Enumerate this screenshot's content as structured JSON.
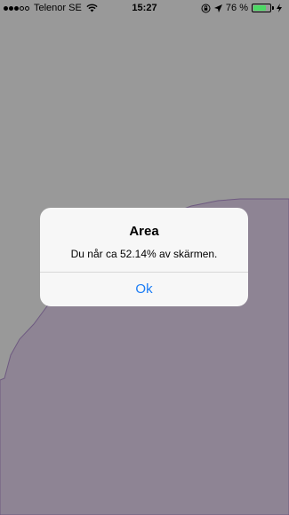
{
  "status_bar": {
    "carrier": "Telenor SE",
    "time": "15:27",
    "battery_percent": "76 %",
    "battery_level": 0.76,
    "signal_bars_filled": 3,
    "signal_bars_total": 5
  },
  "map": {
    "fill_color": "#8e8494",
    "stroke_color": "#6e5a80",
    "background_color": "#999999"
  },
  "alert": {
    "title": "Area",
    "message": "Du når ca 52.14% av skärmen.",
    "ok_label": "Ok",
    "button_color": "#1a7cf5"
  }
}
